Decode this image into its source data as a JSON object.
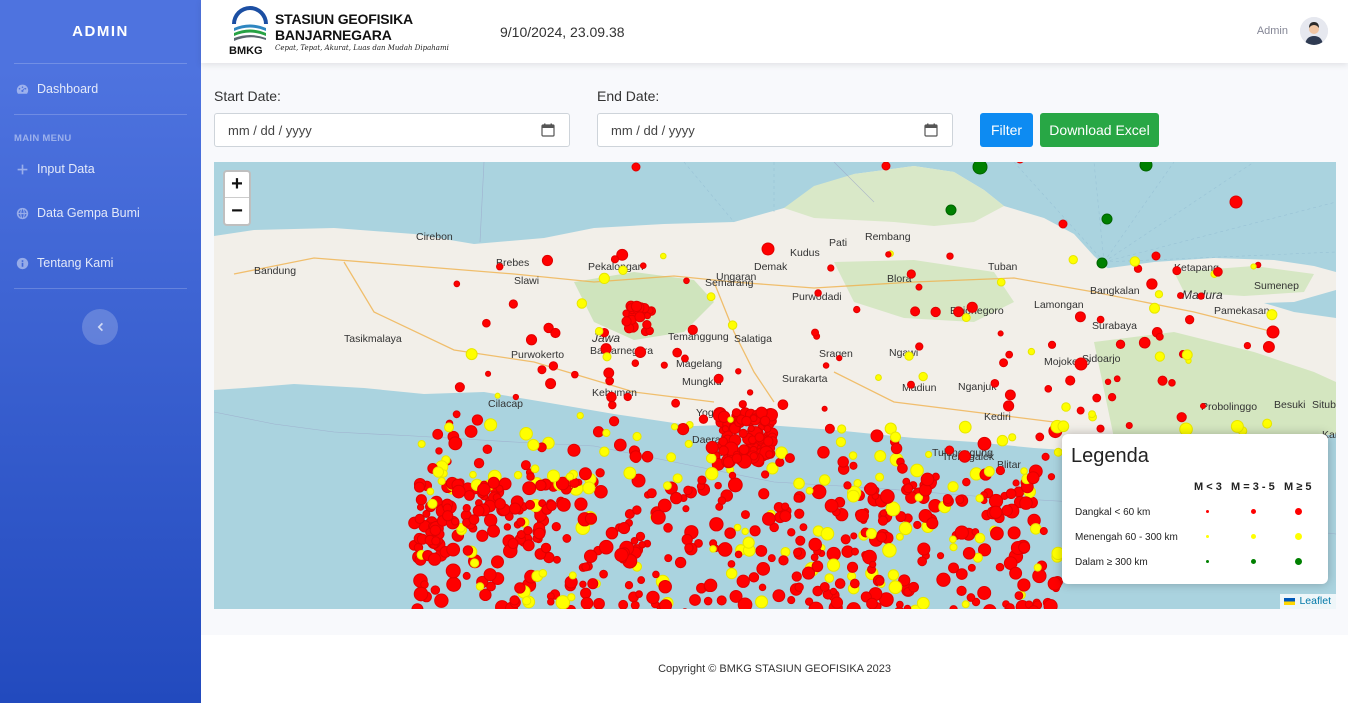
{
  "sidebar": {
    "brand": "ADMIN",
    "items": [
      {
        "label": "Dashboard",
        "icon": "dashboard-icon"
      },
      {
        "label": "Input Data",
        "icon": "plus-icon"
      },
      {
        "label": "Data Gempa Bumi",
        "icon": "globe-icon"
      },
      {
        "label": "Tentang Kami",
        "icon": "info-icon"
      }
    ],
    "heading": "MAIN MENU",
    "toggle_icon": "chevron-left-icon"
  },
  "topbar": {
    "logo_line1": "STASIUN GEOFISIKA",
    "logo_line2": "BANJARNEGARA",
    "logo_tagline": "Cepat, Tepat, Akurat, Luas dan Mudah Dipahami",
    "logo_abbr": "BMKG",
    "datetime": "9/10/2024, 23.09.38",
    "user_name": "Admin"
  },
  "filters": {
    "start_label": "Start Date:",
    "start_placeholder": "mm / dd / yyyy",
    "end_label": "End Date:",
    "end_placeholder": "mm / dd / yyyy",
    "filter_button": "Filter",
    "excel_button": "Download Excel"
  },
  "map": {
    "zoom_in": "+",
    "zoom_out": "−",
    "attribution": "Leaflet",
    "places": [
      "Bandung",
      "Cirebon",
      "Brebes",
      "Pekalongan",
      "Semarang",
      "Kudus",
      "Pati",
      "Rembang",
      "Tuban",
      "Tasikmalaya",
      "Slawi",
      "Jawa",
      "Banjarnegara",
      "Purwokerto",
      "Temanggung",
      "Salatiga",
      "Ungaran",
      "Demak",
      "Purwodadi",
      "Blora",
      "Bojonegoro",
      "Lamongan",
      "Bangkalan",
      "Ketapang",
      "Sumenep",
      "Madura",
      "Pamekasan",
      "Surabaya",
      "Magelang",
      "Sragen",
      "Ngawi",
      "Mojokerto",
      "Sidoarjo",
      "Cilacap",
      "Kebumen",
      "Mungkid",
      "Yogya",
      "Surakarta",
      "Madiun",
      "Nganjuk",
      "Kediri",
      "Blitar",
      "Tulungagung",
      "Trenggalek",
      "Probolinggo",
      "Besuki",
      "Situbondo",
      "Karta",
      "Daerah",
      "Yogya"
    ],
    "legend": {
      "title": "Legenda",
      "col1": "M < 3",
      "col2": "M = 3 - 5",
      "col3": "M ≥ 5",
      "row1": "Dangkal < 60 km",
      "row2": "Menengah 60 - 300 km",
      "row3": "Dalam ≥ 300 km",
      "color_shallow": "#ff0000",
      "color_medium": "#ffff00",
      "color_deep": "#008000"
    }
  },
  "footer": "Copyright © BMKG STASIUN GEOFISIKA 2023"
}
